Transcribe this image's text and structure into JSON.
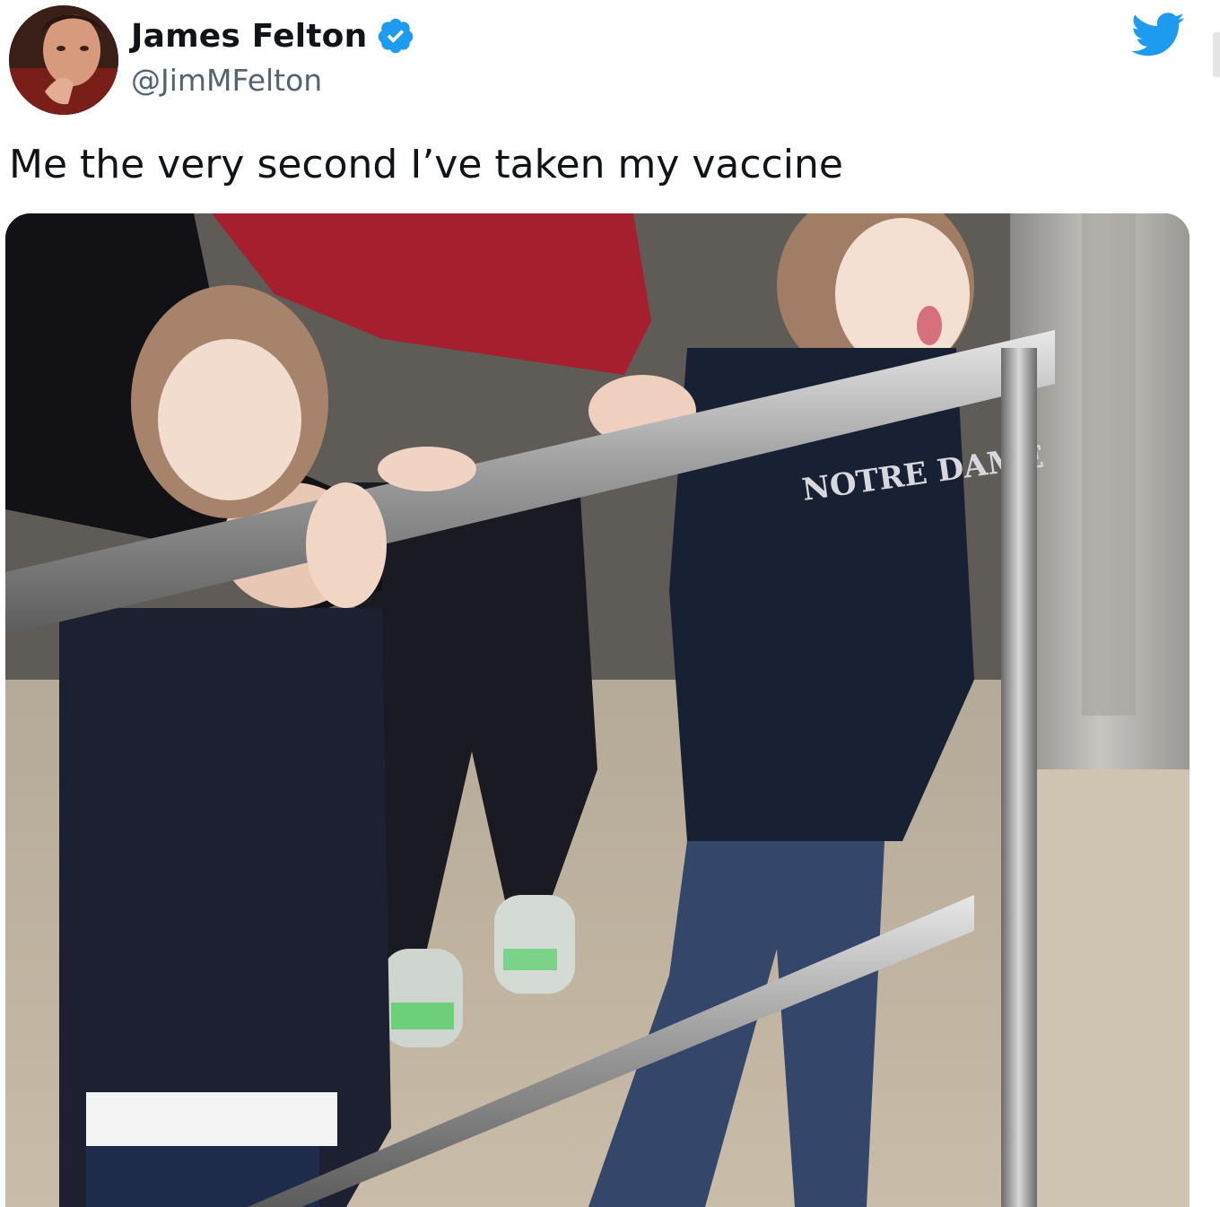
{
  "tweet": {
    "author": {
      "display_name": "James Felton",
      "handle": "@JimMFelton",
      "verified": true,
      "avatar_icon": "profile-photo"
    },
    "text": "Me the very second I’ve taken my vaccine",
    "media": {
      "type": "photo",
      "sweatshirt_text": "NOTRE DAME"
    }
  },
  "icons": {
    "verified": "verified-badge-icon",
    "logo": "twitter-bird-icon"
  },
  "colors": {
    "twitter_blue": "#1d9bf0",
    "name": "#0f1419",
    "handle": "#536471"
  }
}
